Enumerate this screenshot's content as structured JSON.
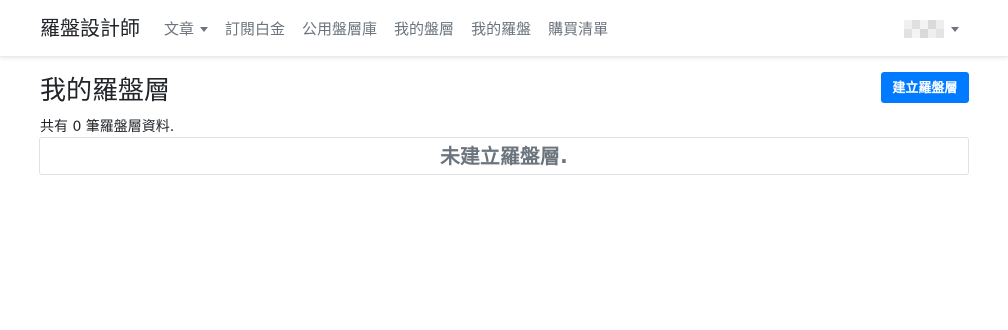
{
  "navbar": {
    "brand": "羅盤設計師",
    "items": [
      {
        "label": "文章",
        "has_dropdown": true
      },
      {
        "label": "訂閱白金",
        "has_dropdown": false
      },
      {
        "label": "公用盤層庫",
        "has_dropdown": false
      },
      {
        "label": "我的盤層",
        "has_dropdown": false
      },
      {
        "label": "我的羅盤",
        "has_dropdown": false
      },
      {
        "label": "購買清單",
        "has_dropdown": false
      }
    ],
    "user_menu": {
      "avatar": "pixelated-avatar",
      "has_dropdown": true
    }
  },
  "main": {
    "title": "我的羅盤層",
    "create_button_label": "建立羅盤層",
    "record_count_text": "共有 0 筆羅盤層資料.",
    "empty_message": "未建立羅盤層."
  },
  "colors": {
    "primary": "#007bff",
    "nav_text": "#6c757d",
    "text": "#212529",
    "border": "#dee2e6"
  }
}
